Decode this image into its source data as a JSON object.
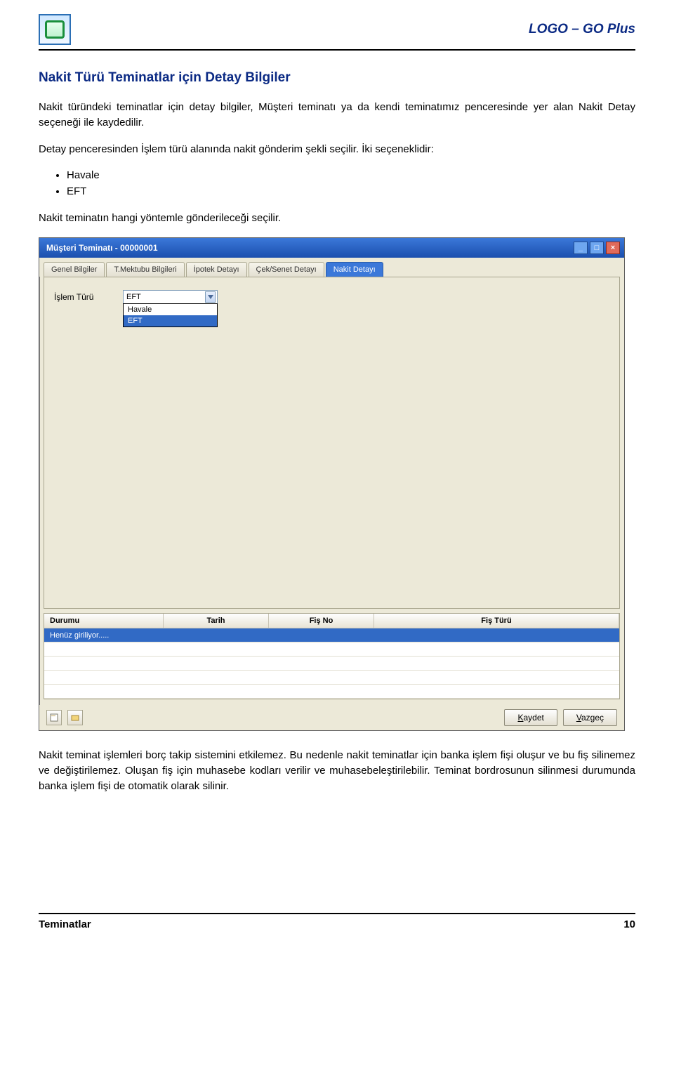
{
  "header": {
    "brand": "LOGO – GO Plus"
  },
  "section_title": "Nakit Türü Teminatlar için Detay Bilgiler",
  "para1": "Nakit türündeki teminatlar için detay bilgiler, Müşteri teminatı ya da kendi teminatımız penceresinde yer alan Nakit Detay seçeneği ile kaydedilir.",
  "para2": "Detay penceresinden İşlem türü alanında nakit gönderim şekli seçilir. İki seçeneklidir:",
  "bullets": [
    "Havale",
    "EFT"
  ],
  "para3": "Nakit teminatın hangi yöntemle gönderileceği seçilir.",
  "window": {
    "title": "Müşteri Teminatı - 00000001",
    "tabs": {
      "genel": "Genel Bilgiler",
      "tmektubu": "T.Mektubu Bilgileri",
      "ipotek": "İpotek Detayı",
      "ceksenet": "Çek/Senet Detayı",
      "nakit": "Nakit Detayı"
    },
    "form": {
      "islem_turu_label": "İşlem Türü",
      "islem_turu_value": "EFT",
      "options": {
        "havale": "Havale",
        "eft": "EFT"
      }
    },
    "grid": {
      "headers": {
        "durumu": "Durumu",
        "tarih": "Tarih",
        "fisno": "Fiş No",
        "fisturu": "Fiş Türü"
      },
      "row1_status": "Henüz giriliyor....."
    },
    "buttons": {
      "kaydet": "Kaydet",
      "vazgec": "Vazgeç"
    }
  },
  "para4": "Nakit teminat işlemleri borç takip sistemini etkilemez. Bu nedenle nakit teminatlar için banka işlem fişi oluşur ve bu fiş silinemez ve değiştirilemez. Oluşan fiş için muhasebe kodları verilir ve muhasebeleştirilebilir. Teminat bordrosunun silinmesi durumunda banka işlem fişi de otomatik olarak silinir.",
  "footer": {
    "left": "Teminatlar",
    "right": "10"
  }
}
